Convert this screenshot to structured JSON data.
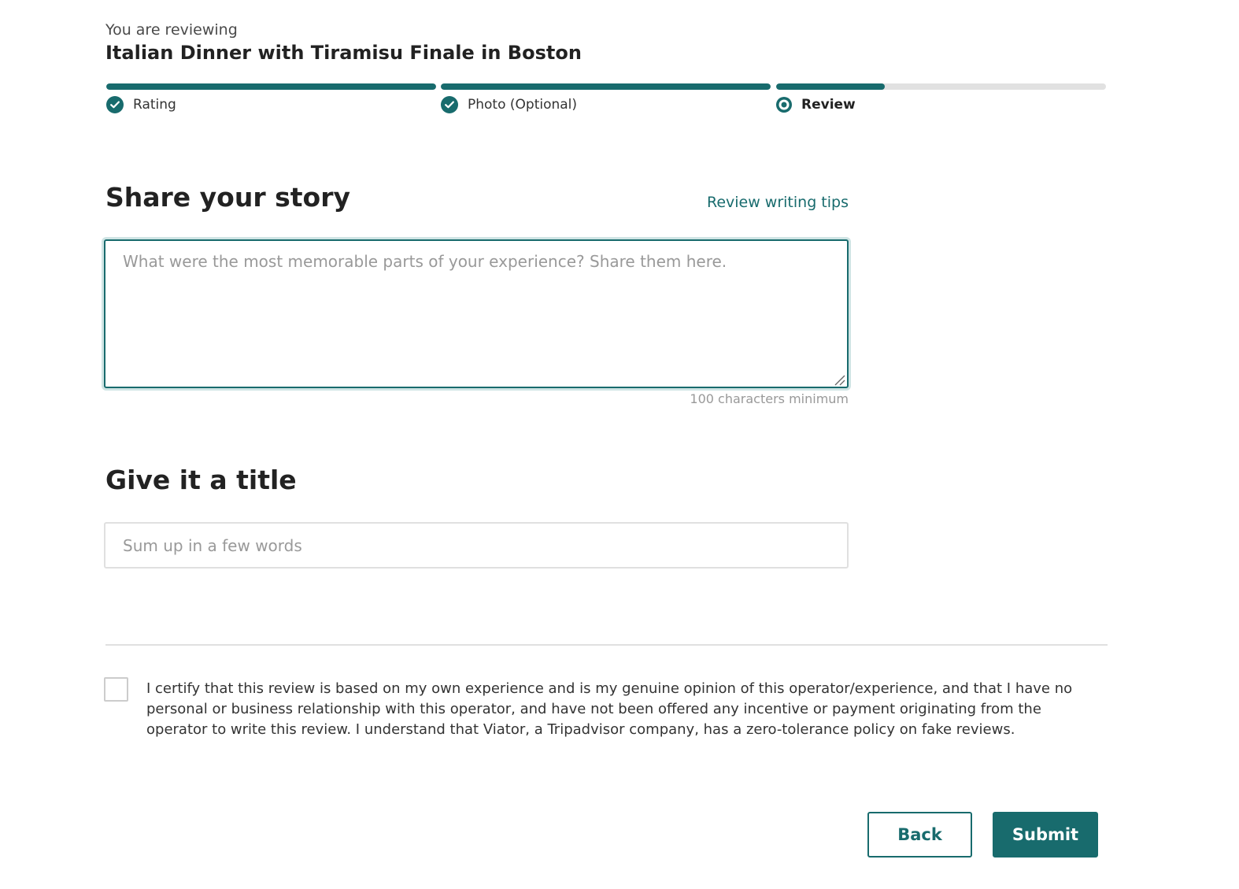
{
  "header": {
    "reviewing_label": "You are reviewing",
    "experience_title": "Italian Dinner with Tiramisu Finale in Boston"
  },
  "progress": {
    "steps": [
      {
        "label": "Rating",
        "state": "complete",
        "fill_fraction": 1.0,
        "icon": "check-icon"
      },
      {
        "label": "Photo (Optional)",
        "state": "complete",
        "fill_fraction": 1.0,
        "icon": "check-icon"
      },
      {
        "label": "Review",
        "state": "current",
        "fill_fraction": 0.33,
        "icon": "current-step-dot-icon"
      }
    ]
  },
  "story": {
    "heading": "Share your story",
    "tips_link": "Review writing tips",
    "placeholder": "What were the most memorable parts of your experience? Share them here.",
    "value": "",
    "hint": "100 characters minimum"
  },
  "title_section": {
    "heading": "Give it a title",
    "placeholder": "Sum up in a few words",
    "value": ""
  },
  "certification": {
    "checked": false,
    "text": "I certify that this review is based on my own experience and is my genuine opinion of this operator/experience, and that I have no personal or business relationship with this operator, and have not been offered any incentive or payment originating from the operator to write this review. I understand that Viator, a Tripadvisor company, has a zero-tolerance policy on fake reviews."
  },
  "actions": {
    "back_label": "Back",
    "submit_label": "Submit"
  },
  "colors": {
    "accent": "#186b6d",
    "track": "#e1e1e1",
    "border": "#e0e0e0",
    "placeholder": "#999999"
  }
}
